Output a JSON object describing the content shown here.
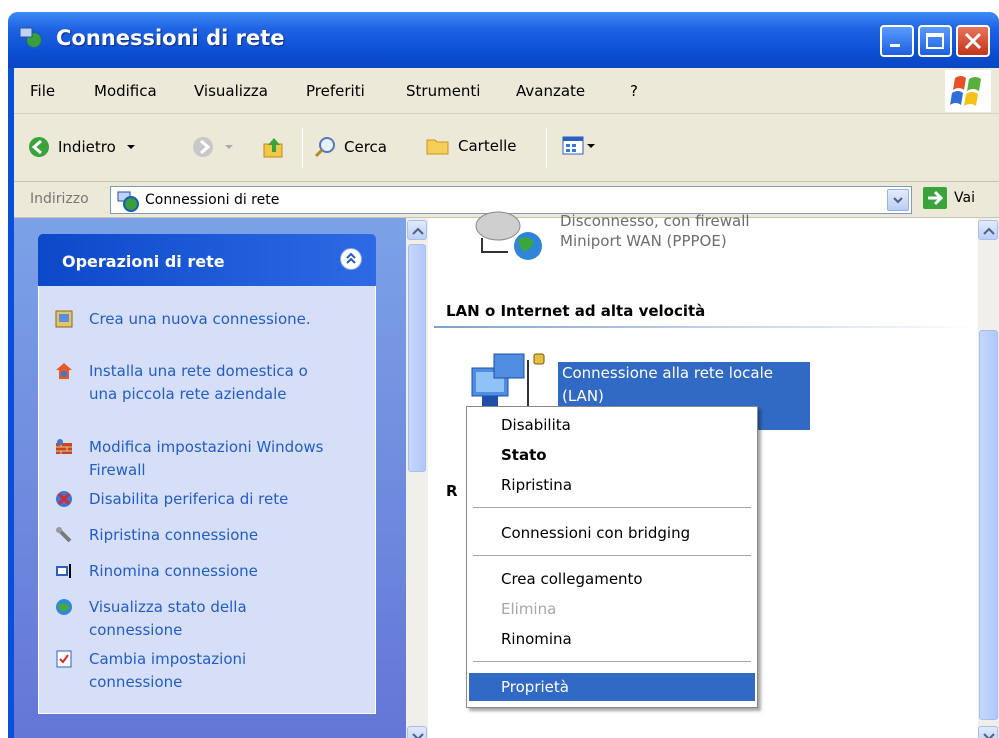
{
  "window": {
    "title": "Connessioni di rete"
  },
  "menu": [
    "File",
    "Modifica",
    "Visualizza",
    "Preferiti",
    "Strumenti",
    "Avanzate",
    "?"
  ],
  "toolbar": {
    "back": "Indietro",
    "search": "Cerca",
    "folders": "Cartelle"
  },
  "address": {
    "label": "Indirizzo",
    "value": "Connessioni di rete",
    "go": "Vai"
  },
  "tasks": {
    "title": "Operazioni di rete",
    "items": [
      {
        "label": "Crea una nuova connessione.",
        "icon": "new-connection-icon"
      },
      {
        "label": "Installa una rete domestica o una piccola rete aziendale",
        "icon": "home-network-icon"
      },
      {
        "label": "Modifica impostazioni Windows Firewall",
        "icon": "firewall-icon"
      },
      {
        "label": "Disabilita periferica di rete",
        "icon": "disable-device-icon"
      },
      {
        "label": "Ripristina connessione",
        "icon": "repair-icon"
      },
      {
        "label": "Rinomina connessione",
        "icon": "rename-icon"
      },
      {
        "label": "Visualizza stato della connessione",
        "icon": "status-icon"
      },
      {
        "label": "Cambia impostazioni connessione",
        "icon": "properties-icon"
      }
    ]
  },
  "content": {
    "wan_status": "Disconnesso, con firewall",
    "wan_device": "Miniport WAN (PPPOE)",
    "lan_group": "LAN o Internet ad alta velocità",
    "lan_name_line1": "Connessione alla rete locale",
    "lan_name_line2": "(LAN)",
    "other_group_initial": "R"
  },
  "context_menu": {
    "items": [
      "Disabilita",
      "Stato",
      "Ripristina",
      "Connessioni con bridging",
      "Crea collegamento",
      "Elimina",
      "Rinomina",
      "Proprietà"
    ]
  },
  "colors": {
    "title_blue": "#0a4fd8",
    "selection": "#316ac5",
    "task_link": "#215dc6"
  }
}
